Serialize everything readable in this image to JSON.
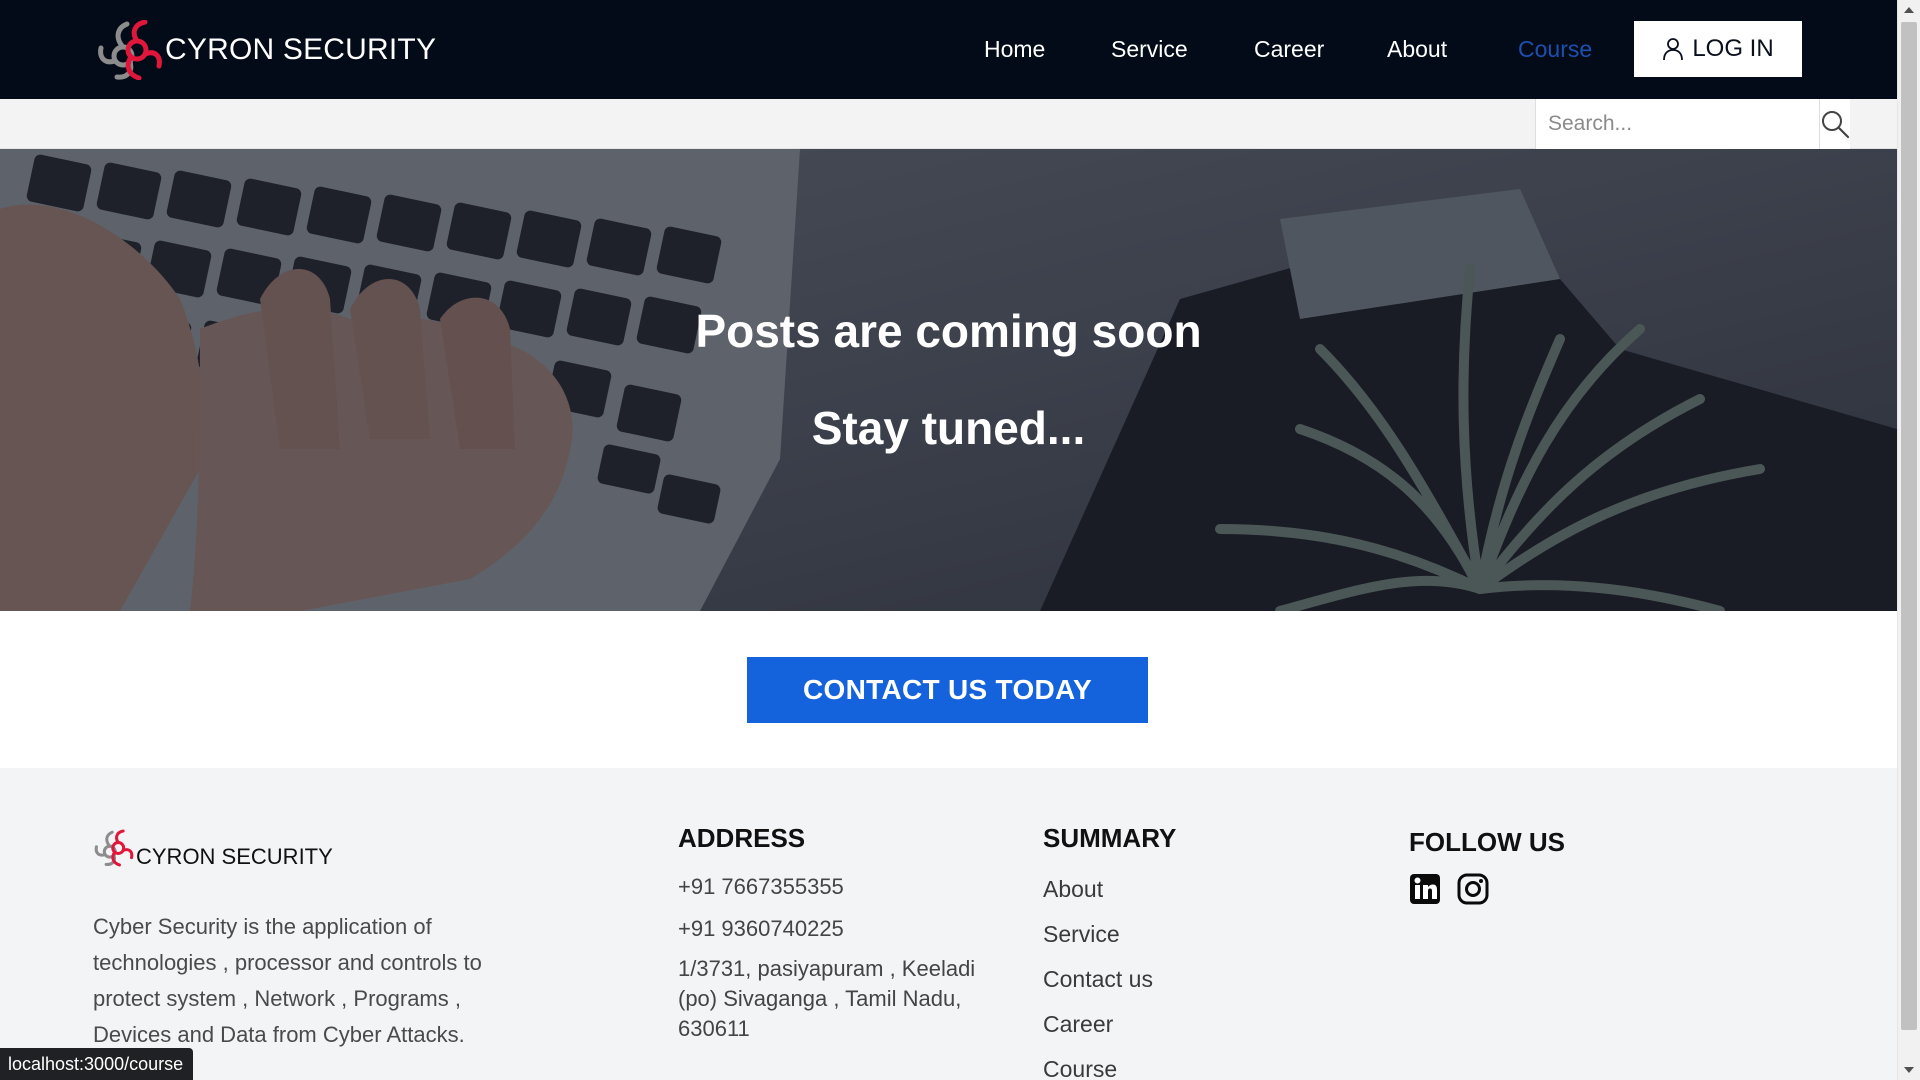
{
  "navbar": {
    "brand_name": "CYRON SECURITY",
    "links": [
      {
        "label": "Home"
      },
      {
        "label": "Service"
      },
      {
        "label": "Career"
      },
      {
        "label": "About"
      },
      {
        "label": "Course"
      }
    ],
    "active_link": "Course",
    "login_label": "LOG IN",
    "colors": {
      "background": "#020b17",
      "active_link": "#1c4fae",
      "logo_red": "#e0173b",
      "logo_gray": "#8c8c8c"
    }
  },
  "search": {
    "placeholder": "Search...",
    "value": "",
    "icon": "search-icon"
  },
  "hero": {
    "title": "Posts are coming soon",
    "subtitle": "Stay tuned..."
  },
  "cta": {
    "label": "CONTACT US TODAY",
    "color": "#1462dc"
  },
  "footer": {
    "brand_name": "CYRON SECURITY",
    "description": "Cyber Security is the application of technologies , processor and controls to protect system , Network , Programs , Devices and Data from Cyber Attacks.",
    "address": {
      "heading": "ADDRESS",
      "phone1": "+91 7667355355",
      "phone2": "+91 9360740225",
      "street": "1/3731, pasiyapuram , Keeladi (po) Sivaganga , Tamil Nadu, 630611"
    },
    "summary": {
      "heading": "SUMMARY",
      "links": [
        {
          "label": "About"
        },
        {
          "label": "Service"
        },
        {
          "label": "Contact us"
        },
        {
          "label": "Career"
        },
        {
          "label": "Course"
        }
      ]
    },
    "follow": {
      "heading": "FOLLOW US",
      "icons": [
        "linkedin-icon",
        "instagram-icon"
      ]
    }
  },
  "status_bar": {
    "url": "localhost:3000/course"
  }
}
